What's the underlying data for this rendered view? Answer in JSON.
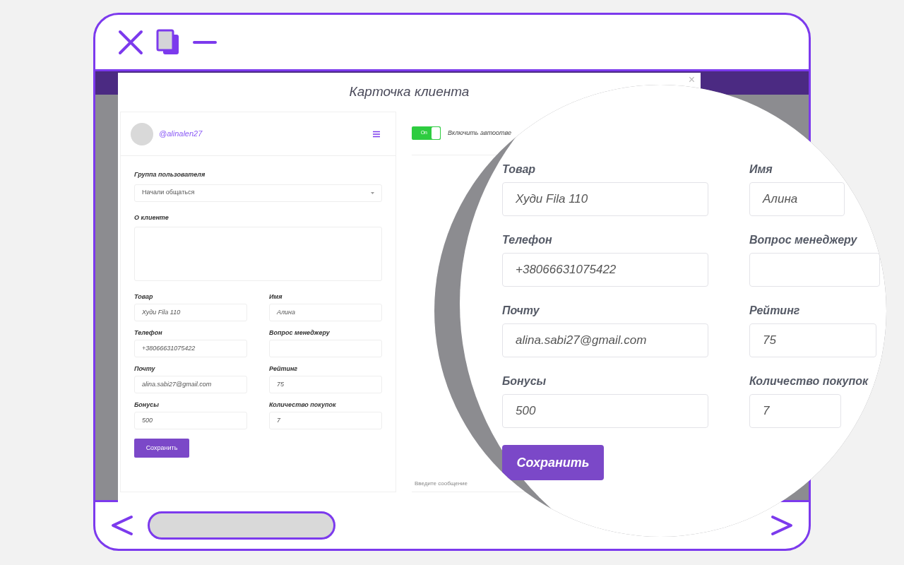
{
  "modal": {
    "title": "Карточка клиента",
    "close": "×",
    "user": {
      "username": "@alinalen27"
    },
    "group": {
      "label": "Группа пользователя",
      "value": "Начали общаться"
    },
    "about": {
      "label": "О клиенте"
    },
    "fields": [
      {
        "label": "Товар",
        "value": "Худи Fila 110"
      },
      {
        "label": "Имя",
        "value": "Алина"
      },
      {
        "label": "Телефон",
        "value": "+38066631075422"
      },
      {
        "label": "Вопрос менеджеру"
      },
      {
        "label": "Почту",
        "value": "alina.sabi27@gmail.com"
      },
      {
        "label": "Рейтинг",
        "value": "75"
      },
      {
        "label": "Бонусы",
        "value": "500"
      },
      {
        "label": "Количество покупок",
        "value": "7"
      }
    ],
    "save_button": "Сохранить",
    "autoreply": {
      "on": true,
      "toggle_label": "On",
      "label": "Включить автоотве"
    },
    "message": {
      "placeholder": "Введите сообщение"
    }
  },
  "magnifier": {
    "fields": [
      {
        "label": "Товар",
        "value": "Худи Fila 110"
      },
      {
        "label": "Имя",
        "value": "Алина"
      },
      {
        "label": "Телефон",
        "value": "+38066631075422"
      },
      {
        "label": "Вопрос менеджеру"
      },
      {
        "label": "Почту",
        "value": "alina.sabi27@gmail.com"
      },
      {
        "label": "Рейтинг",
        "value": "75"
      },
      {
        "label": "Бонусы",
        "value": "500"
      },
      {
        "label": "Количество покупок",
        "value": "7"
      }
    ],
    "save_button": "Сохранить"
  }
}
